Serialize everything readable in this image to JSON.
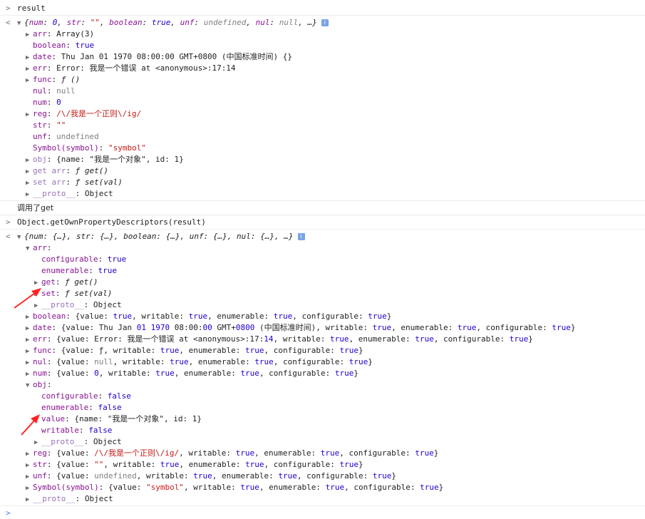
{
  "console": {
    "cmd1": "result",
    "out1_summary": {
      "prefix": "{",
      "parts": [
        {
          "k": "num",
          "sep": ": ",
          "v": "0",
          "c": "n"
        },
        {
          "k": "str",
          "sep": ": ",
          "v": "\"\"",
          "c": "s"
        },
        {
          "k": "boolean",
          "sep": ": ",
          "v": "true",
          "c": "b"
        },
        {
          "k": "unf",
          "sep": ": ",
          "v": "undefined",
          "c": "g"
        },
        {
          "k": "nul",
          "sep": ": ",
          "v": "null",
          "c": "g"
        }
      ],
      "suffix": ", …}"
    },
    "out1_props": [
      {
        "key": "arr",
        "val": "Array(3)",
        "vc": "plain",
        "expand": true,
        "kc": "k"
      },
      {
        "key": "boolean",
        "val": "true",
        "vc": "b",
        "expand": false,
        "kc": "k"
      },
      {
        "key": "date",
        "val": "Thu Jan 01 1970 08:00:00 GMT+0800 (中国标准时间) {}",
        "vc": "plain",
        "expand": true,
        "kc": "k"
      },
      {
        "key": "err",
        "val": "Error: 我是一个错误 at <anonymous>:17:14",
        "vc": "plain",
        "expand": true,
        "kc": "k"
      },
      {
        "key": "func",
        "val": "ƒ ()",
        "vc": "fn",
        "expand": true,
        "kc": "k"
      },
      {
        "key": "nul",
        "val": "null",
        "vc": "g",
        "expand": false,
        "kc": "k"
      },
      {
        "key": "num",
        "val": "0",
        "vc": "n",
        "expand": false,
        "kc": "k"
      },
      {
        "key": "reg",
        "val": "/\\/我是一个正则\\/ig/",
        "vc": "s",
        "expand": true,
        "kc": "k"
      },
      {
        "key": "str",
        "val": "\"\"",
        "vc": "s",
        "expand": false,
        "kc": "k"
      },
      {
        "key": "unf",
        "val": "undefined",
        "vc": "g",
        "expand": false,
        "kc": "k"
      },
      {
        "key": "Symbol(symbol)",
        "val": "\"symbol\"",
        "vc": "s",
        "expand": false,
        "kc": "k"
      },
      {
        "key": "obj",
        "val": "{name: \"我是一个对象\", id: 1}",
        "vc": "plain",
        "expand": true,
        "kc": "kp"
      },
      {
        "key": "get arr",
        "val": "ƒ get()",
        "vc": "fn",
        "expand": true,
        "kc": "kp"
      },
      {
        "key": "set arr",
        "val": "ƒ set(val)",
        "vc": "fn",
        "expand": true,
        "kc": "kp"
      },
      {
        "key": "__proto__",
        "val": "Object",
        "vc": "plain",
        "expand": true,
        "kc": "kp"
      }
    ],
    "log1": "调用了get",
    "cmd2": "Object.getOwnPropertyDescriptors(result)",
    "out2_summary": "{num: {…}, str: {…}, boolean: {…}, unf: {…}, nul: {…}, …}",
    "arr_key": "arr",
    "arr_children": [
      {
        "key": "configurable",
        "val": "true",
        "vc": "b",
        "expand": false,
        "kc": "k"
      },
      {
        "key": "enumerable",
        "val": "true",
        "vc": "b",
        "expand": false,
        "kc": "k"
      },
      {
        "key": "get",
        "val": "ƒ get()",
        "vc": "fn",
        "expand": true,
        "kc": "k"
      },
      {
        "key": "set",
        "val": "ƒ set(val)",
        "vc": "fn",
        "expand": true,
        "kc": "k"
      },
      {
        "key": "__proto__",
        "val": "Object",
        "vc": "plain",
        "expand": true,
        "kc": "kp"
      }
    ],
    "desc_props": [
      {
        "key": "boolean",
        "val": "{value: true, writable: true, enumerable: true, configurable: true}"
      },
      {
        "key": "date",
        "val": "{value: Thu Jan 01 1970 08:00:00 GMT+0800 (中国标准时间), writable: true, enumerable: true, configurable: true}"
      },
      {
        "key": "err",
        "val": "{value: Error: 我是一个错误 at <anonymous>:17:14, writable: true, enumerable: true, configurable: true}"
      },
      {
        "key": "func",
        "val": "{value: ƒ, writable: true, enumerable: true, configurable: true}"
      },
      {
        "key": "nul",
        "val": "{value: null, writable: true, enumerable: true, configurable: true}"
      },
      {
        "key": "num",
        "val": "{value: 0, writable: true, enumerable: true, configurable: true}"
      }
    ],
    "obj_key": "obj",
    "obj_children": [
      {
        "key": "configurable",
        "val": "false",
        "vc": "b",
        "expand": false,
        "kc": "k"
      },
      {
        "key": "enumerable",
        "val": "false",
        "vc": "b",
        "expand": false,
        "kc": "k"
      },
      {
        "key": "value",
        "val": "{name: \"我是一个对象\", id: 1}",
        "vc": "plain",
        "expand": true,
        "kc": "k"
      },
      {
        "key": "writable",
        "val": "false",
        "vc": "b",
        "expand": false,
        "kc": "k"
      },
      {
        "key": "__proto__",
        "val": "Object",
        "vc": "plain",
        "expand": true,
        "kc": "kp"
      }
    ],
    "desc_props2": [
      {
        "key": "reg",
        "val": "{value: /\\/我是一个正则\\/ig/, writable: true, enumerable: true, configurable: true}",
        "kc": "k"
      },
      {
        "key": "str",
        "val": "{value: \"\", writable: true, enumerable: true, configurable: true}",
        "kc": "k"
      },
      {
        "key": "unf",
        "val": "{value: undefined, writable: true, enumerable: true, configurable: true}",
        "kc": "k"
      },
      {
        "key": "Symbol(symbol)",
        "val": "{value: \"symbol\", writable: true, enumerable: true, configurable: true}",
        "kc": "k"
      },
      {
        "key": "__proto__",
        "val": "Object",
        "kc": "kp"
      }
    ],
    "prompt_glyph": ">",
    "result_glyph": "<",
    "info_glyph": "i"
  },
  "colors": {
    "key": "#881391",
    "key_proto": "#9a73bc",
    "string": "#c41a16",
    "number": "#1c00cf",
    "null": "#808080",
    "annotation_arrow": "#ff2222"
  }
}
